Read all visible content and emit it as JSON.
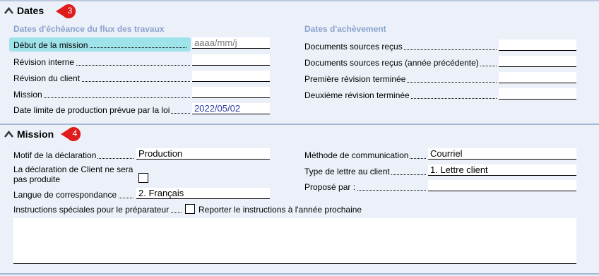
{
  "dates": {
    "title": "Dates",
    "badge": "3",
    "workflow_heading": "Dates d'échéance du flux des travaux",
    "completion_heading": "Dates d'achèvement",
    "fields": {
      "debut_label": "Début de la mission",
      "debut_placeholder": "aaaa/mm/j",
      "revision_interne_label": "Révision interne",
      "revision_client_label": "Révision du client",
      "mission_label": "Mission",
      "date_limite_label": "Date limite de production prévue par la loi",
      "date_limite_value": "2022/05/02",
      "docs_recus_label": "Documents sources reçus",
      "docs_recus_prev_label": "Documents sources reçus (année précédente)",
      "premiere_revision_label": "Première révision terminée",
      "deuxieme_revision_label": "Deuxième révision terminée"
    }
  },
  "mission": {
    "title": "Mission",
    "badge": "4",
    "motif_label": "Motif de la déclaration",
    "motif_value": "Production",
    "non_produite_label_1": "La déclaration de Client ne sera",
    "non_produite_label_2": "pas produite",
    "langue_label": "Langue de correspondance",
    "langue_value": "2. Français",
    "methode_label": "Méthode de communication",
    "methode_value": "Courriel",
    "type_lettre_label": "Type de lettre au client",
    "type_lettre_value": "1. Lettre client",
    "propose_label": "Proposé par :",
    "propose_value": "",
    "instructions_label": "Instructions spéciales pour le préparateur",
    "reporter_label": "Reporter le instructions à l'année prochaine",
    "instructions_text": ""
  },
  "colors": {
    "badge": "#e01b1b",
    "heading": "#8aa1cd",
    "highlight": "#9fe3ea",
    "value_blue": "#2b3aa5"
  }
}
